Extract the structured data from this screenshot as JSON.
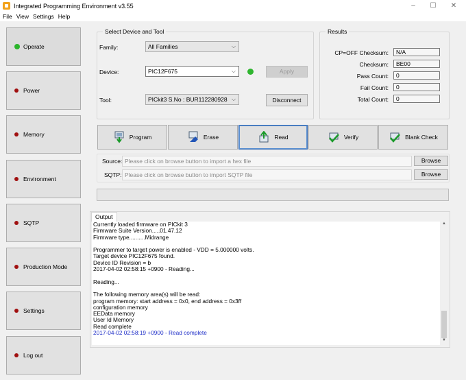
{
  "window": {
    "title": "Integrated Programming Environment v3.55",
    "controls": {
      "minimize": "–",
      "maximize": "☐",
      "close": "✕"
    }
  },
  "menu": [
    "File",
    "View",
    "Settings",
    "Help"
  ],
  "sidebar": {
    "items": [
      {
        "label": "Operate",
        "status": "green"
      },
      {
        "label": "Power",
        "status": "red"
      },
      {
        "label": "Memory",
        "status": "red"
      },
      {
        "label": "Environment",
        "status": "red"
      },
      {
        "label": "SQTP",
        "status": "red"
      },
      {
        "label": "Production Mode",
        "status": "red"
      },
      {
        "label": "Settings",
        "status": "red"
      },
      {
        "label": "Log out",
        "status": "red"
      }
    ]
  },
  "device_group": {
    "title": "Select Device and Tool",
    "family_label": "Family:",
    "family_value": "All Families",
    "device_label": "Device:",
    "device_value": "PIC12F675",
    "apply_label": "Apply",
    "tool_label": "Tool:",
    "tool_value": "PICkit3 S.No : BUR112280928",
    "disconnect_label": "Disconnect"
  },
  "results": {
    "title": "Results",
    "rows": [
      {
        "label": "CP=OFF Checksum:",
        "value": "N/A"
      },
      {
        "label": "Checksum:",
        "value": "BE00"
      },
      {
        "label": "Pass Count:",
        "value": "0"
      },
      {
        "label": "Fail Count:",
        "value": "0"
      },
      {
        "label": "Total Count:",
        "value": "0"
      }
    ]
  },
  "actions": {
    "program": "Program",
    "erase": "Erase",
    "read": "Read",
    "verify": "Verify",
    "blank_check": "Blank Check"
  },
  "source": {
    "label": "Source:",
    "placeholder": "Please click on browse button to import a hex file",
    "browse": "Browse"
  },
  "sqtp": {
    "label": "SQTP:",
    "placeholder": "Please click on browse button to import SQTP file",
    "browse": "Browse"
  },
  "progress": {
    "fraction": 0
  },
  "output": {
    "tab": "Output",
    "lines": [
      "Currently loaded firmware on PICkit 3",
      "Firmware Suite Version.....01.47.12",
      "Firmware type..........Midrange",
      "",
      "Programmer to target power is enabled - VDD = 5.000000 volts.",
      "Target device PIC12F675 found.",
      "Device ID Revision = b",
      "2017-04-02 02:58:15 +0900 - Reading...",
      "",
      "Reading...",
      "",
      "The following memory area(s) will be read:",
      "program memory: start address = 0x0, end address = 0x3ff",
      "configuration memory",
      "EEData memory",
      "User Id Memory",
      "Read complete"
    ],
    "final_line": "2017-04-02 02:58:19 +0900 - Read complete"
  }
}
